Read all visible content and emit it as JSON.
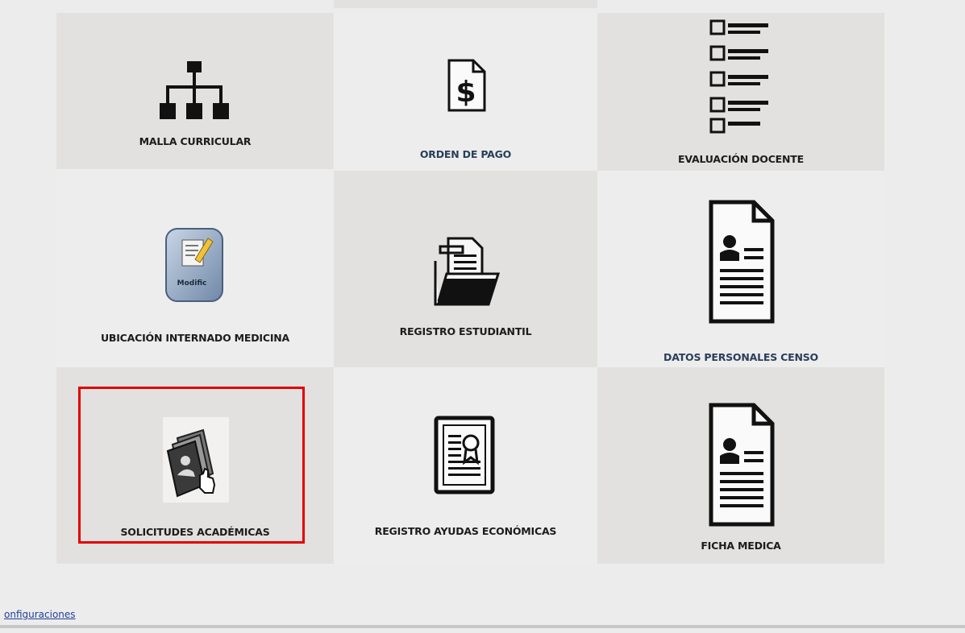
{
  "tiles": [
    {
      "label": "MALLA CURRICULAR",
      "icon": "org-chart-icon"
    },
    {
      "label": "ORDEN DE PAGO",
      "icon": "dollar-document-icon"
    },
    {
      "label": "EVALUACIÓN DOCENTE",
      "icon": "checklist-icon"
    },
    {
      "label": "UBICACIÓN INTERNADO MEDICINA",
      "icon": "modify-document-icon",
      "icon_text": "Modific"
    },
    {
      "label": "REGISTRO ESTUDIANTIL",
      "icon": "folder-documents-icon"
    },
    {
      "label": "DATOS PERSONALES CENSO",
      "icon": "resume-document-icon"
    },
    {
      "label": "SOLICITUDES ACADÉMICAS",
      "icon": "academic-requests-icon",
      "highlighted": true
    },
    {
      "label": "REGISTRO AYUDAS ECONÓMICAS",
      "icon": "certificate-icon"
    },
    {
      "label": "FICHA MEDICA",
      "icon": "resume-document-icon"
    }
  ],
  "footer": {
    "link": "onfiguraciones"
  },
  "colors": {
    "highlight": "#e30000",
    "link": "#1f3f9a",
    "tile_dark": "#e3e1df",
    "tile_light": "#ededed"
  }
}
